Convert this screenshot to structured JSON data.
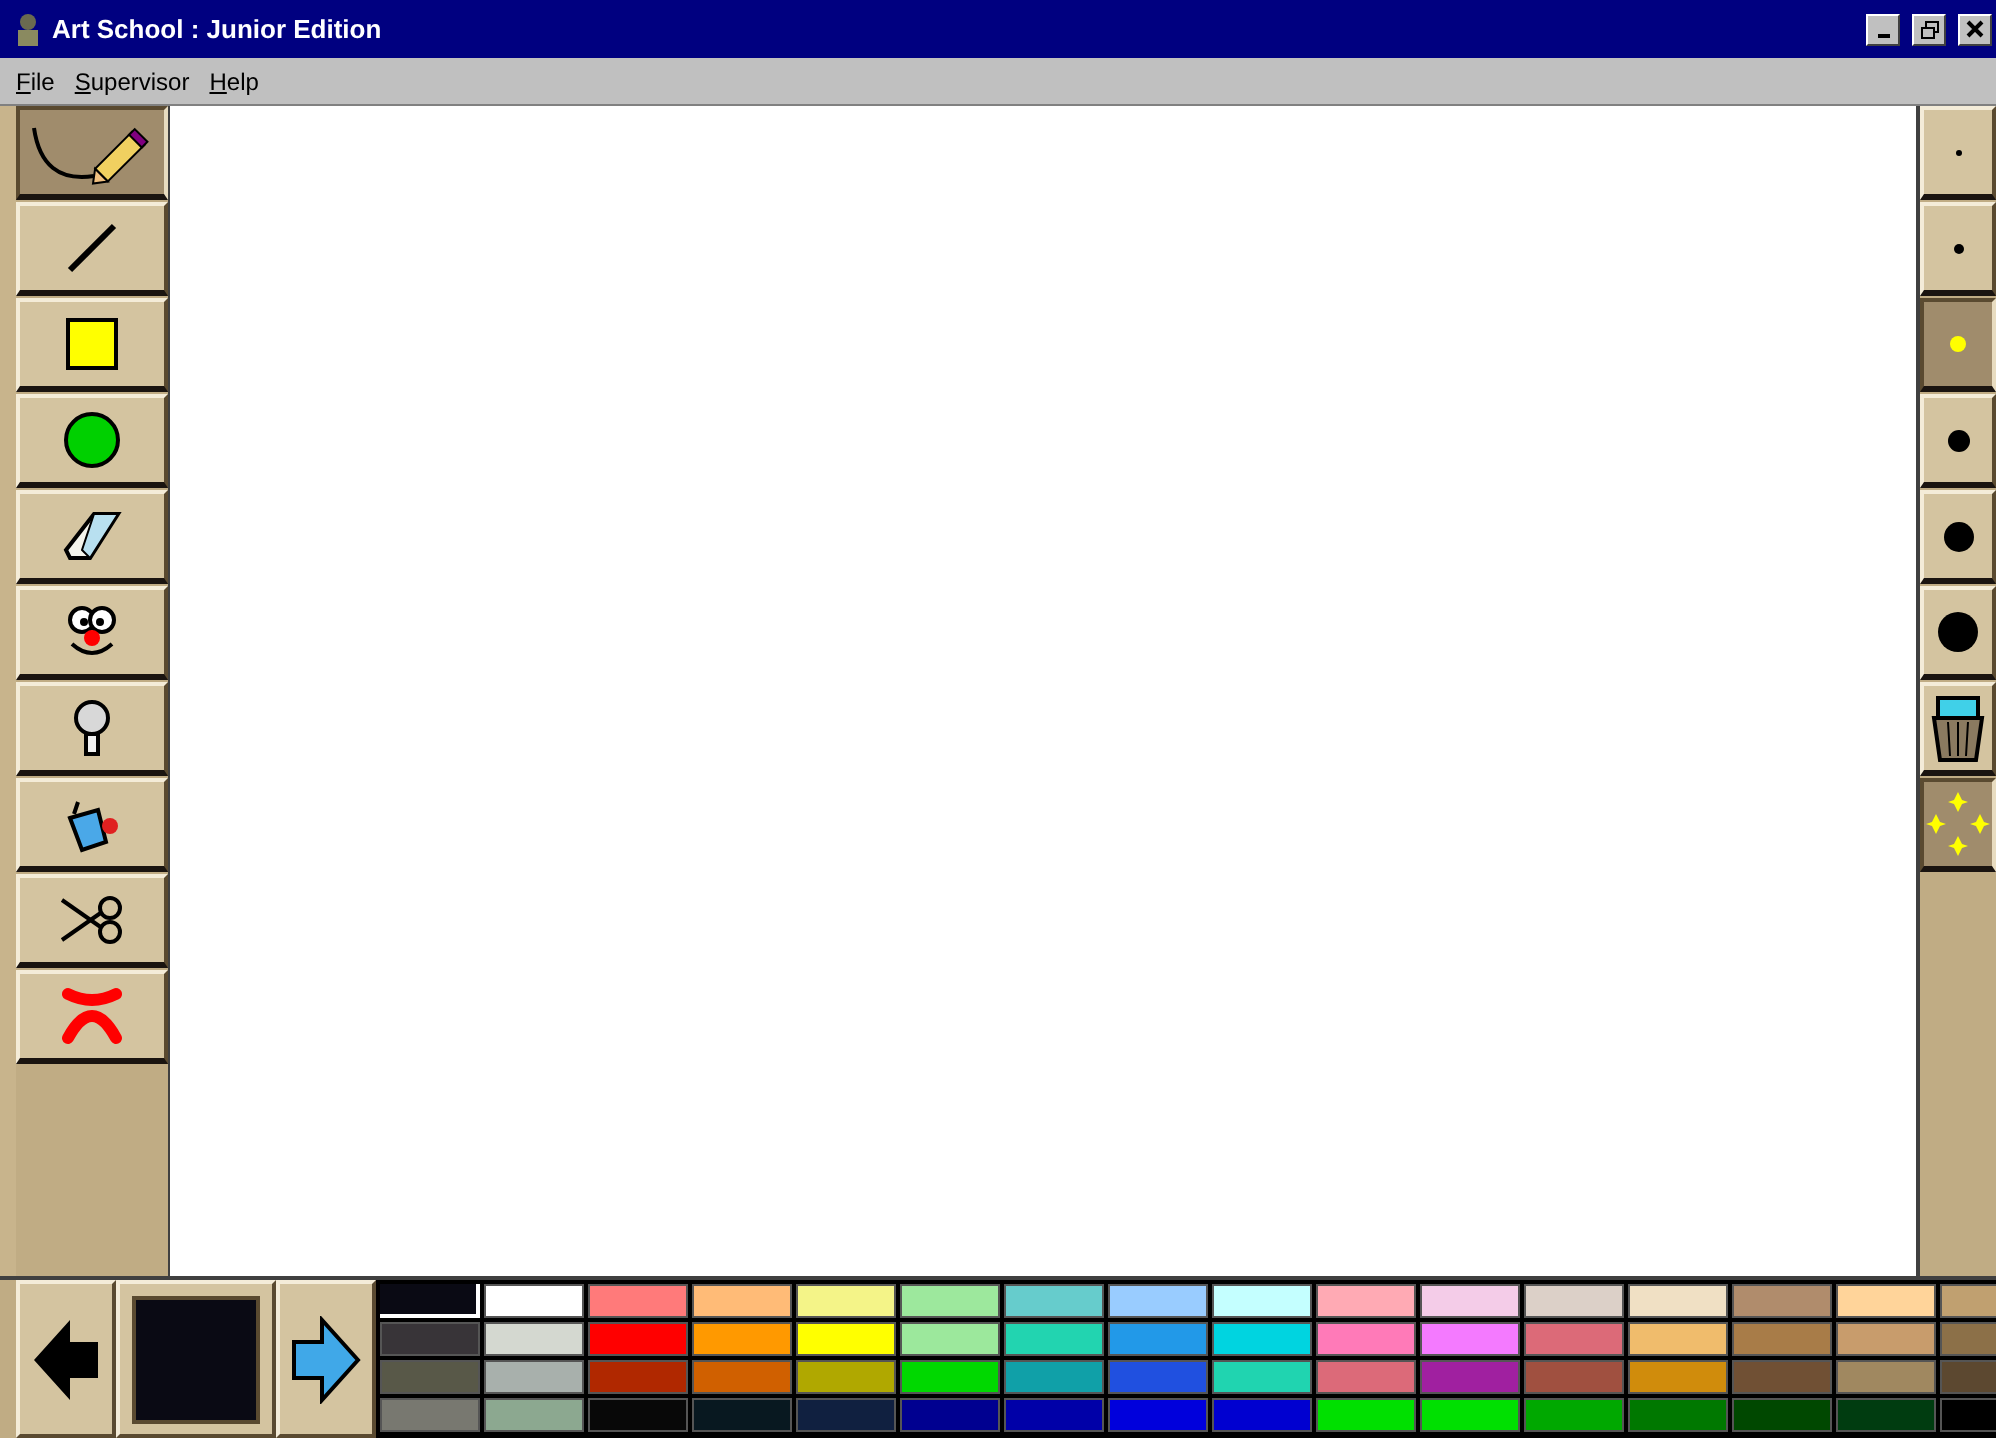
{
  "window": {
    "title": "Art School : Junior Edition"
  },
  "menu": [
    "File",
    "Supervisor",
    "Help"
  ],
  "tools": [
    {
      "kind": "pencil",
      "selected": true
    },
    {
      "kind": "line",
      "selected": false
    },
    {
      "kind": "rectangle",
      "selected": false
    },
    {
      "kind": "circle",
      "selected": false
    },
    {
      "kind": "eraser",
      "selected": false
    },
    {
      "kind": "face",
      "selected": false
    },
    {
      "kind": "bulb",
      "selected": false
    },
    {
      "kind": "bucket",
      "selected": false
    },
    {
      "kind": "scissors",
      "selected": false
    },
    {
      "kind": "cross",
      "selected": false
    }
  ],
  "sizes": [
    {
      "kind": "tiny",
      "selected": false
    },
    {
      "kind": "small",
      "selected": false
    },
    {
      "kind": "medium",
      "selected": true
    },
    {
      "kind": "large",
      "selected": false
    },
    {
      "kind": "larger",
      "selected": false
    },
    {
      "kind": "largest",
      "selected": false
    },
    {
      "kind": "trash",
      "selected": false
    },
    {
      "kind": "sparkle",
      "selected": true
    }
  ],
  "current_color": {
    "color": "#0a0a14"
  },
  "palette": [
    [
      {
        "color": "#0a0a14",
        "selected": true
      },
      {
        "color": "#ffffff",
        "selected": false
      },
      {
        "color": "#ff7a7a",
        "selected": false
      },
      {
        "color": "#ffbb77",
        "selected": false
      },
      {
        "color": "#f4f488",
        "selected": false
      },
      {
        "color": "#9de89d",
        "selected": false
      },
      {
        "color": "#66cccc",
        "selected": false
      },
      {
        "color": "#99ccff",
        "selected": false
      },
      {
        "color": "#c4ffff",
        "selected": false
      },
      {
        "color": "#ffaab4",
        "selected": false
      },
      {
        "color": "#f4cce8",
        "selected": false
      },
      {
        "color": "#dcd0c8",
        "selected": false
      },
      {
        "color": "#f0e0c4",
        "selected": false
      },
      {
        "color": "#b08c6c",
        "selected": false
      },
      {
        "color": "#ffd49a",
        "selected": false
      },
      {
        "color": "#c0a070",
        "selected": false
      }
    ],
    [
      {
        "color": "#383438",
        "selected": false
      },
      {
        "color": "#d4d8d0",
        "selected": false
      },
      {
        "color": "#ff0000",
        "selected": false
      },
      {
        "color": "#ff9900",
        "selected": false
      },
      {
        "color": "#ffff00",
        "selected": false
      },
      {
        "color": "#9ce89c",
        "selected": false
      },
      {
        "color": "#22d4b0",
        "selected": false
      },
      {
        "color": "#2299e8",
        "selected": false
      },
      {
        "color": "#00d4e0",
        "selected": false
      },
      {
        "color": "#ff7ab8",
        "selected": false
      },
      {
        "color": "#f47aff",
        "selected": false
      },
      {
        "color": "#dc6a78",
        "selected": false
      },
      {
        "color": "#f0bc6c",
        "selected": false
      },
      {
        "color": "#a87c48",
        "selected": false
      },
      {
        "color": "#c89c6c",
        "selected": false
      },
      {
        "color": "#8c7048",
        "selected": false
      }
    ],
    [
      {
        "color": "#585848",
        "selected": false
      },
      {
        "color": "#a8b0ac",
        "selected": false
      },
      {
        "color": "#b02800",
        "selected": false
      },
      {
        "color": "#d06000",
        "selected": false
      },
      {
        "color": "#b0a800",
        "selected": false
      },
      {
        "color": "#00d800",
        "selected": false
      },
      {
        "color": "#10a0a8",
        "selected": false
      },
      {
        "color": "#2050e0",
        "selected": false
      },
      {
        "color": "#20d4b0",
        "selected": false
      },
      {
        "color": "#dc6a79",
        "selected": false
      },
      {
        "color": "#a020a0",
        "selected": false
      },
      {
        "color": "#a05040",
        "selected": false
      },
      {
        "color": "#d08c0c",
        "selected": false
      },
      {
        "color": "#705034",
        "selected": false
      },
      {
        "color": "#a08860",
        "selected": false
      },
      {
        "color": "#5c4830",
        "selected": false
      }
    ],
    [
      {
        "color": "#787870",
        "selected": false
      },
      {
        "color": "#8ca890",
        "selected": false
      },
      {
        "color": "#080808",
        "selected": false
      },
      {
        "color": "#081820",
        "selected": false
      },
      {
        "color": "#102040",
        "selected": false
      },
      {
        "color": "#000090",
        "selected": false
      },
      {
        "color": "#0000a8",
        "selected": false
      },
      {
        "color": "#0000dc",
        "selected": false
      },
      {
        "color": "#0000d0",
        "selected": false
      },
      {
        "color": "#00e000",
        "selected": false
      },
      {
        "color": "#00e001",
        "selected": false
      },
      {
        "color": "#00a800",
        "selected": false
      },
      {
        "color": "#007800",
        "selected": false
      },
      {
        "color": "#004800",
        "selected": false
      },
      {
        "color": "#003c10",
        "selected": false
      },
      {
        "color": "#000000",
        "selected": false
      }
    ]
  ]
}
